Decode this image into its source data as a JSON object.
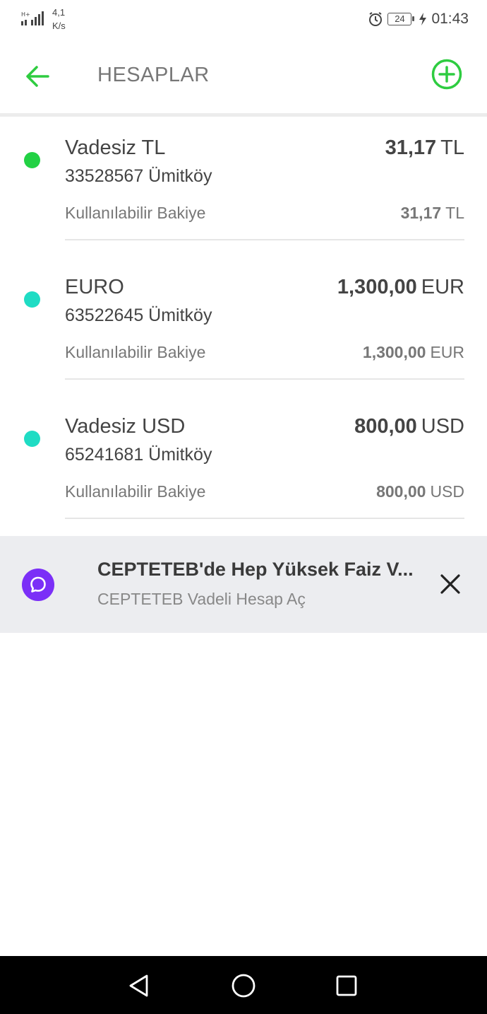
{
  "status_bar": {
    "speed_value": "4,1",
    "speed_unit": "K/s",
    "battery": "24",
    "time": "01:43"
  },
  "header": {
    "title": "HESAPLAR",
    "back_icon": "arrow-left-icon",
    "add_icon": "plus-circle-icon",
    "accent_color": "#2ecc40"
  },
  "accounts": [
    {
      "name": "Vadesiz TL",
      "branch": "33528567 Ümitköy",
      "amount": "31,17",
      "currency": "TL",
      "available_label": "Kullanılabilir Bakiye",
      "available_amount": "31,17",
      "available_currency": "TL",
      "dot_color": "#22d144"
    },
    {
      "name": "EURO",
      "branch": "63522645 Ümitköy",
      "amount": "1,300,00",
      "currency": "EUR",
      "available_label": "Kullanılabilir Bakiye",
      "available_amount": "1,300,00",
      "available_currency": "EUR",
      "dot_color": "#1fdcc4"
    },
    {
      "name": "Vadesiz USD",
      "branch": "65241681 Ümitköy",
      "amount": "800,00",
      "currency": "USD",
      "available_label": "Kullanılabilir Bakiye",
      "available_amount": "800,00",
      "available_currency": "USD",
      "dot_color": "#1fdcc4"
    }
  ],
  "promo": {
    "title": "CEPTETEB'de Hep Yüksek Faiz V...",
    "subtitle": "CEPTETEB Vadeli Hesap Aç",
    "icon": "chat-bubble-icon",
    "icon_color": "#7b2ff7",
    "close_icon": "close-icon"
  },
  "nav_bar": {
    "back_icon": "nav-back-triangle-icon",
    "home_icon": "nav-home-circle-icon",
    "recents_icon": "nav-recents-square-icon"
  }
}
